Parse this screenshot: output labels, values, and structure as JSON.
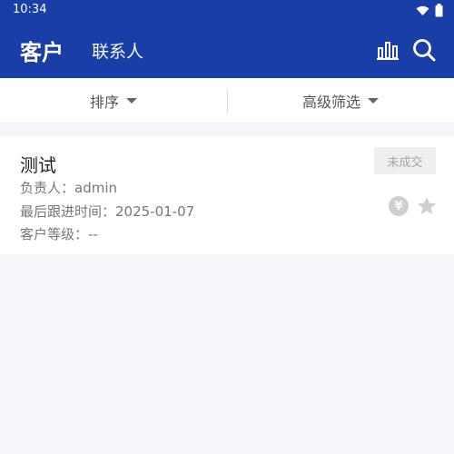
{
  "status_bar": {
    "time": "10:34"
  },
  "app_bar": {
    "tabs": [
      {
        "label": "客户"
      },
      {
        "label": "联系人"
      }
    ],
    "icons": [
      "chart-icon",
      "search-icon"
    ]
  },
  "filter_bar": {
    "sort_label": "排序",
    "advanced_label": "高级筛选"
  },
  "card": {
    "title": "测试",
    "owner": "负责人：admin",
    "last_follow": "最后跟进时间：2025-01-07",
    "level": "客户等级：--",
    "status": "未成交",
    "icons": [
      "coin-icon",
      "star-icon"
    ]
  },
  "colors": {
    "primary": "#1a3ea8",
    "background": "#f5f6fa"
  }
}
